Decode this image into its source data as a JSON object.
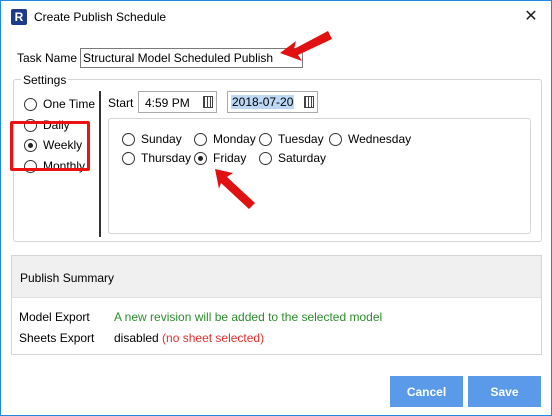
{
  "window": {
    "title": "Create Publish Schedule",
    "app_icon_letter": "R"
  },
  "task": {
    "label": "Task Name",
    "value": "Structural Model Scheduled Publish"
  },
  "settings": {
    "legend": "Settings",
    "frequencies": [
      {
        "label": "One Time",
        "checked": false
      },
      {
        "label": "Daily",
        "checked": false
      },
      {
        "label": "Weekly",
        "checked": true
      },
      {
        "label": "Monthly",
        "checked": false
      }
    ],
    "start_label": "Start",
    "start_time": "4:59 PM",
    "start_date": "2018-07-20",
    "days": [
      {
        "label": "Sunday",
        "checked": false
      },
      {
        "label": "Monday",
        "checked": false
      },
      {
        "label": "Tuesday",
        "checked": false
      },
      {
        "label": "Wednesday",
        "checked": false
      },
      {
        "label": "Thursday",
        "checked": false
      },
      {
        "label": "Friday",
        "checked": true
      },
      {
        "label": "Saturday",
        "checked": false
      }
    ]
  },
  "summary": {
    "title": "Publish Summary",
    "model_export_label": "Model Export",
    "model_export_value": "A new revision will be added to the selected model",
    "sheets_export_label": "Sheets Export",
    "sheets_export_status": "disabled",
    "sheets_export_note": "(no sheet selected)"
  },
  "buttons": {
    "cancel": "Cancel",
    "save": "Save"
  },
  "colors": {
    "accent": "#5b9ae8",
    "annotation": "#e11111",
    "ok_text": "#2e8b2e",
    "warn_text": "#e03030"
  }
}
